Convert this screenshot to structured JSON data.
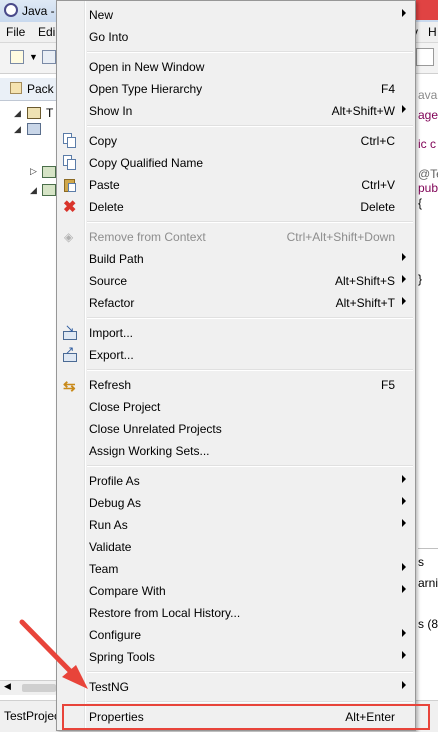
{
  "window": {
    "title": "Java -"
  },
  "menubar": {
    "items": [
      "File",
      "Edi",
      "v",
      "H"
    ]
  },
  "package_explorer": {
    "tab_label": "Pack",
    "tree_root_label": "T"
  },
  "editor": {
    "lines": [
      {
        "text": "ava",
        "color": "#8a8a8a"
      },
      {
        "text": "age",
        "color": "#7f0055"
      },
      {
        "text": "ic c",
        "color": "#7f0055"
      },
      {
        "text": "@Tes",
        "color": "#646464"
      },
      {
        "text": "publ",
        "color": "#7f0055"
      },
      {
        "text": "{",
        "color": "#000000"
      },
      {
        "text": "}",
        "color": "#000000"
      }
    ]
  },
  "console": {
    "lines": [
      "s",
      "arnin",
      "s (8"
    ]
  },
  "status": {
    "text": "TestProjec"
  },
  "context_menu": {
    "items": [
      {
        "label": "New",
        "accel": "",
        "submenu": true,
        "icon": "",
        "disabled": false
      },
      {
        "label": "Go Into",
        "accel": "",
        "submenu": false,
        "icon": "",
        "disabled": false
      },
      {
        "sep": true
      },
      {
        "label": "Open in New Window",
        "accel": "",
        "submenu": false,
        "icon": "",
        "disabled": false
      },
      {
        "label": "Open Type Hierarchy",
        "accel": "F4",
        "submenu": false,
        "icon": "",
        "disabled": false
      },
      {
        "label": "Show In",
        "accel": "Alt+Shift+W",
        "submenu": true,
        "icon": "",
        "disabled": false
      },
      {
        "sep": true
      },
      {
        "label": "Copy",
        "accel": "Ctrl+C",
        "submenu": false,
        "icon": "copy-icon",
        "disabled": false
      },
      {
        "label": "Copy Qualified Name",
        "accel": "",
        "submenu": false,
        "icon": "copy-qualified-icon",
        "disabled": false
      },
      {
        "label": "Paste",
        "accel": "Ctrl+V",
        "submenu": false,
        "icon": "paste-icon",
        "disabled": false
      },
      {
        "label": "Delete",
        "accel": "Delete",
        "submenu": false,
        "icon": "delete-icon",
        "disabled": false
      },
      {
        "sep": true
      },
      {
        "label": "Remove from Context",
        "accel": "Ctrl+Alt+Shift+Down",
        "submenu": false,
        "icon": "remove-context-icon",
        "disabled": true
      },
      {
        "label": "Build Path",
        "accel": "",
        "submenu": true,
        "icon": "",
        "disabled": false
      },
      {
        "label": "Source",
        "accel": "Alt+Shift+S",
        "submenu": true,
        "icon": "",
        "disabled": false
      },
      {
        "label": "Refactor",
        "accel": "Alt+Shift+T",
        "submenu": true,
        "icon": "",
        "disabled": false
      },
      {
        "sep": true
      },
      {
        "label": "Import...",
        "accel": "",
        "submenu": false,
        "icon": "import-icon",
        "disabled": false
      },
      {
        "label": "Export...",
        "accel": "",
        "submenu": false,
        "icon": "export-icon",
        "disabled": false
      },
      {
        "sep": true
      },
      {
        "label": "Refresh",
        "accel": "F5",
        "submenu": false,
        "icon": "refresh-icon",
        "disabled": false
      },
      {
        "label": "Close Project",
        "accel": "",
        "submenu": false,
        "icon": "",
        "disabled": false
      },
      {
        "label": "Close Unrelated Projects",
        "accel": "",
        "submenu": false,
        "icon": "",
        "disabled": false
      },
      {
        "label": "Assign Working Sets...",
        "accel": "",
        "submenu": false,
        "icon": "",
        "disabled": false
      },
      {
        "sep": true
      },
      {
        "label": "Profile As",
        "accel": "",
        "submenu": true,
        "icon": "",
        "disabled": false
      },
      {
        "label": "Debug As",
        "accel": "",
        "submenu": true,
        "icon": "",
        "disabled": false
      },
      {
        "label": "Run As",
        "accel": "",
        "submenu": true,
        "icon": "",
        "disabled": false
      },
      {
        "label": "Validate",
        "accel": "",
        "submenu": false,
        "icon": "",
        "disabled": false
      },
      {
        "label": "Team",
        "accel": "",
        "submenu": true,
        "icon": "",
        "disabled": false
      },
      {
        "label": "Compare With",
        "accel": "",
        "submenu": true,
        "icon": "",
        "disabled": false
      },
      {
        "label": "Restore from Local History...",
        "accel": "",
        "submenu": false,
        "icon": "",
        "disabled": false
      },
      {
        "label": "Configure",
        "accel": "",
        "submenu": true,
        "icon": "",
        "disabled": false
      },
      {
        "label": "Spring Tools",
        "accel": "",
        "submenu": true,
        "icon": "",
        "disabled": false
      },
      {
        "sep": true
      },
      {
        "label": "TestNG",
        "accel": "",
        "submenu": true,
        "icon": "",
        "disabled": false
      },
      {
        "sep": true
      },
      {
        "label": "Properties",
        "accel": "Alt+Enter",
        "submenu": false,
        "icon": "",
        "disabled": false
      }
    ]
  },
  "annotation": {
    "color": "#e8443a"
  }
}
